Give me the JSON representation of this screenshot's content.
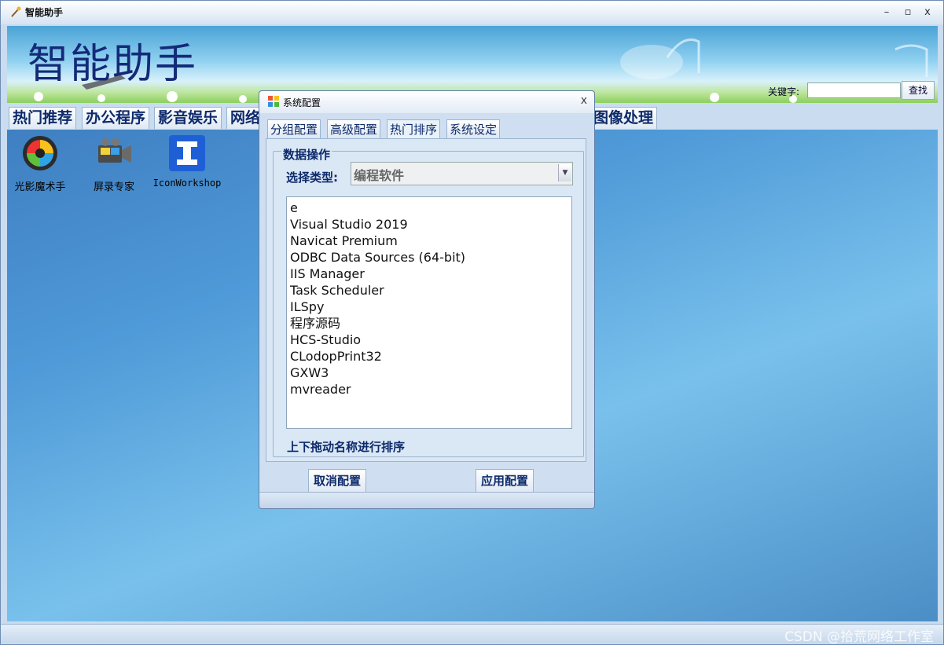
{
  "window": {
    "title": "智能助手",
    "controls": {
      "minimize": "–",
      "maximize": "▫",
      "close": "x"
    }
  },
  "banner": {
    "title": "智能助手",
    "keyword_label": "关键字:",
    "keyword_value": "",
    "search_label": "查找"
  },
  "main_tabs": [
    {
      "label": "热门推荐"
    },
    {
      "label": "办公程序"
    },
    {
      "label": "影音娱乐"
    },
    {
      "label": "网络"
    },
    {
      "label": "图像处理"
    }
  ],
  "desktop_items": [
    {
      "label": "光影魔术手",
      "icon": "aperture-icon"
    },
    {
      "label": "屏录专家",
      "icon": "camera-icon"
    },
    {
      "label": "IconWorkshop",
      "icon": "iconworkshop-icon"
    }
  ],
  "dialog": {
    "title": "系统配置",
    "close": "x",
    "tabs": [
      {
        "label": "分组配置"
      },
      {
        "label": "高级配置"
      },
      {
        "label": "热门排序",
        "active": true
      },
      {
        "label": "系统设定"
      }
    ],
    "group_title": "数据操作",
    "type_label": "选择类型:",
    "type_value": "编程软件",
    "list_items": [
      "e",
      "Visual Studio 2019",
      "Navicat Premium",
      "ODBC Data Sources (64-bit)",
      "IIS Manager",
      "Task Scheduler",
      "ILSpy",
      "程序源码",
      "HCS-Studio",
      "CLodopPrint32",
      "GXW3",
      "mvreader"
    ],
    "hint": "上下拖动名称进行排序",
    "cancel_label": "取消配置",
    "apply_label": "应用配置"
  },
  "watermark": "CSDN @拾荒网络工作室"
}
